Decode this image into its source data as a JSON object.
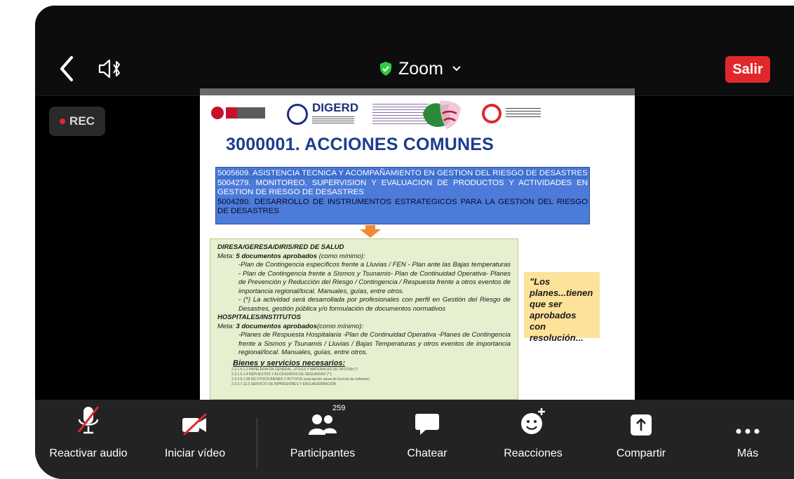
{
  "topbar": {
    "title": "Zoom",
    "exit_label": "Salir",
    "rec_label": "REC"
  },
  "slide": {
    "logos": {
      "digerd": "DIGERD"
    },
    "title": "3000001. ACCIONES COMUNES",
    "blue_lines": [
      "5005609. ASISTENCIA TECNICA Y ACOMPAÑAMIENTO EN GESTION DEL RIESGO DE DESASTRES",
      "5004279. MONITOREO, SUPERVISION Y EVALUACION DE PRODUCTOS Y ACTIVIDADES EN GESTION DE RIESGO DE DESASTRES",
      "5004280. DESARROLLO DE INSTRUMENTOS ESTRATEGICOS PARA LA GESTION DEL RIESGO DE DESASTRES"
    ],
    "green": {
      "h1": "DIRESA/GERESA/DIRIS/RED DE SALUD",
      "meta1_prefix": "Meta: ",
      "meta1_bold": "5 documentos aprobados",
      "meta1_suffix": " (como mínimo):",
      "p1": "-Plan de Contingencia específicos frente a Lluvias / FEN - Plan ante las Bajas temperaturas - Plan de Contingencia frente a Sismos y Tsunamis- Plan de Continuidad Operativa- Planes de Prevención y Reducción del Riesgo / Contingencia / Respuesta frente a otros eventos de importancia regional/local. Manuales, guías, entre otros.",
      "p2": "- (*) La actividad será desarrollada por profesionales con perfil en Gestión del Riesgo de Desastres, gestión pública y/o formulación de documentos normativos",
      "h2": "HOSPITALES/INSTITUTOS",
      "meta2_prefix": "Meta: ",
      "meta2_bold": "3 documentos aprobados",
      "meta2_suffix": "(como mínimo):",
      "p3": "-Planes de Respuesta Hospitalaria -Plan de Continuidad Operativa -Planes de Contingencia frente a Sismos y Tsunamis / Lluvias / Bajas Temperaturas y otros eventos de importancia regional/local. Manuales, guías, entre otros.",
      "bienes": "Bienes y servicios necesarios:",
      "fine": [
        "2.3.1.5.1.2 PAPELERIA EN GENERAL, UTILES Y MATERIALES DE OFICINA (*)",
        "2.3.1.6.1.4 REPUESTOS Y ACCESORIOS DE SEGURIDAD (**)",
        "2.3.2.5.1.99 DE OTROS BIENES Y ACTIVOS (suscripción anual de licencia de software)",
        "2.3.2.7.11.6 SERVICIO DE IMPRESIONES Y ENCUADERNACIÓN"
      ]
    },
    "note": "\"Los planes...tienen que ser aprobados con resolución..."
  },
  "toolbar": {
    "audio_label": "Reactivar audio",
    "video_label": "Iniciar vídeo",
    "participants_label": "Participantes",
    "participants_count": "259",
    "chat_label": "Chatear",
    "reactions_label": "Reacciones",
    "share_label": "Compartir",
    "more_label": "Más"
  },
  "colors": {
    "exit_red": "#e0282c",
    "title_blue": "#1c3d8c",
    "highlight_blue": "#4c7bd9",
    "green_box": "#e6efcf",
    "note_yellow": "#fde29a",
    "shield_green": "#2ecc40"
  }
}
